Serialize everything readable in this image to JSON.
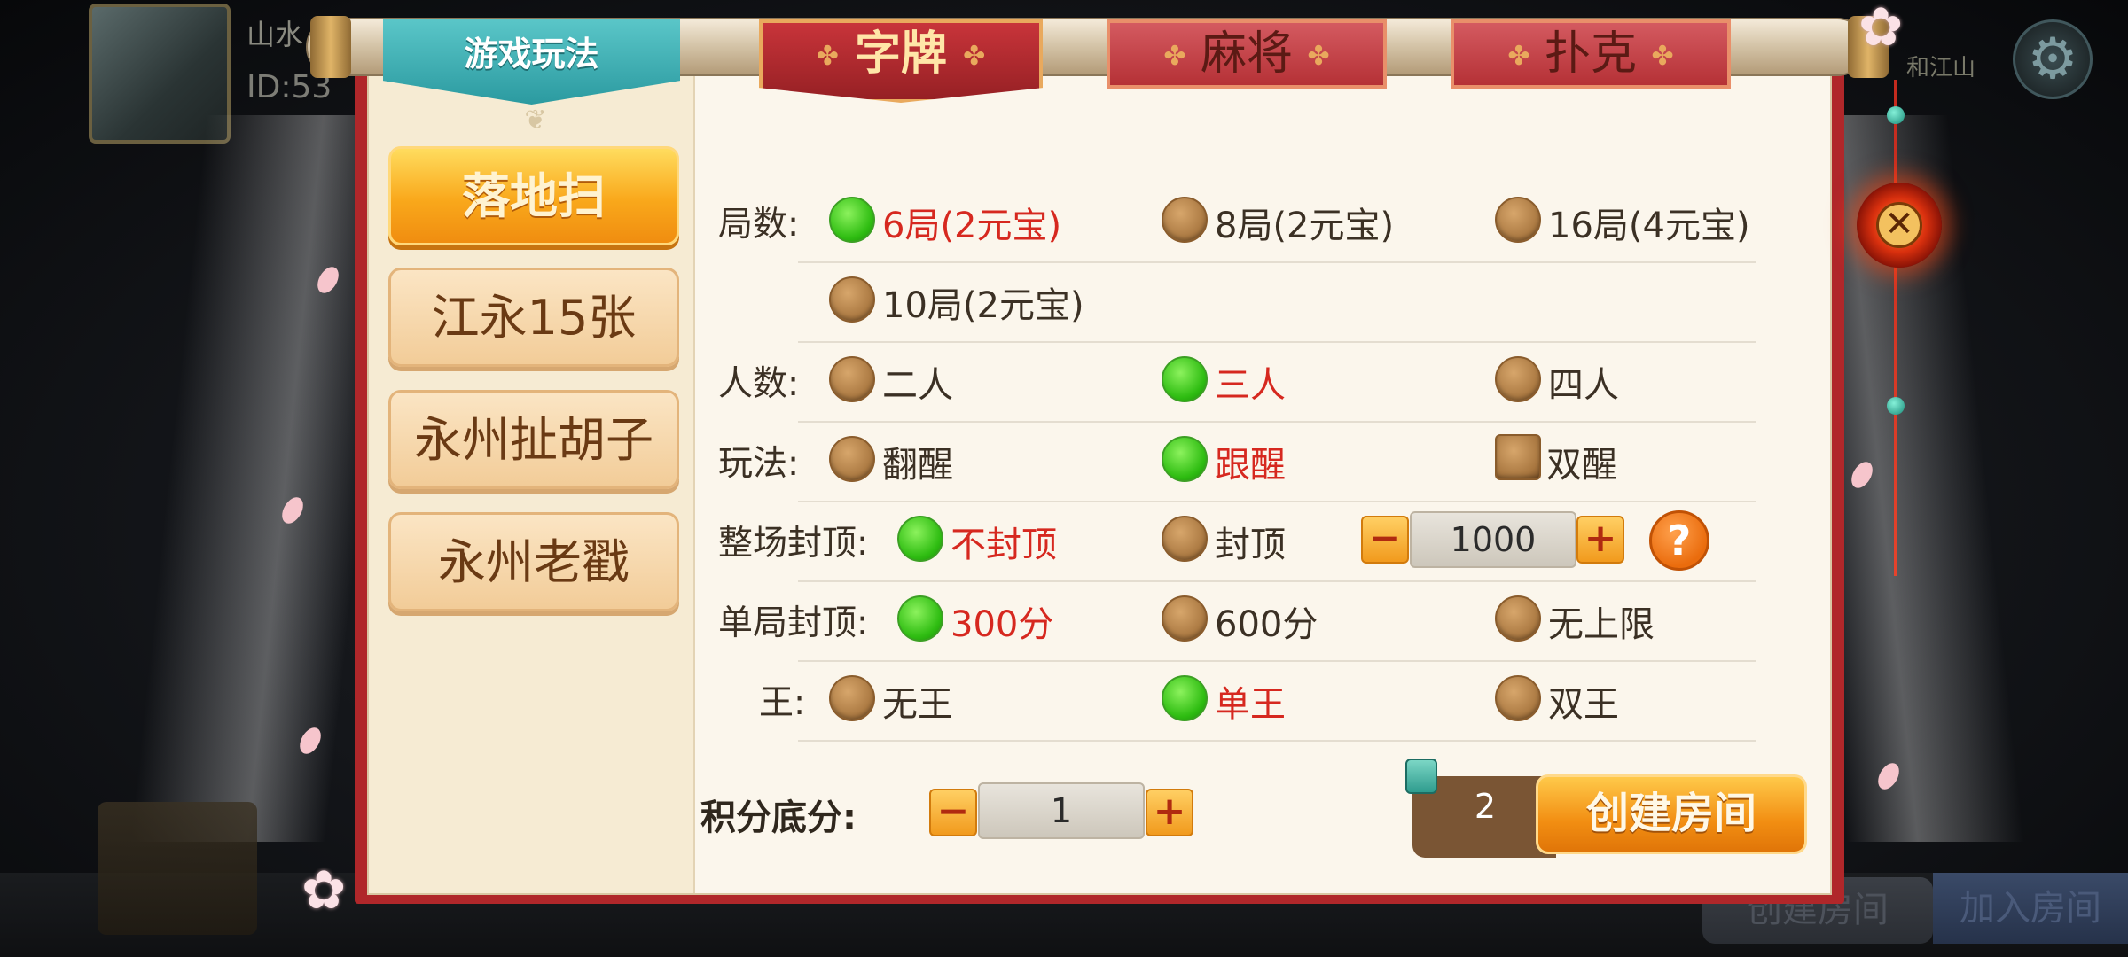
{
  "background": {
    "player_name": "山水",
    "player_id": "ID:53",
    "top_right_text": "和江山",
    "create_room_label": "创建房间",
    "join_room_label": "加入房间"
  },
  "sidebar": {
    "title": "游戏玩法",
    "items": [
      {
        "label": "落地扫",
        "active": true
      },
      {
        "label": "江永15张",
        "active": false
      },
      {
        "label": "永州扯胡子",
        "active": false
      },
      {
        "label": "永州老戳",
        "active": false
      }
    ]
  },
  "categories": [
    {
      "label": "字牌",
      "active": true
    },
    {
      "label": "麻将",
      "active": false
    },
    {
      "label": "扑克",
      "active": false
    }
  ],
  "options": {
    "rounds": {
      "label": "局数:",
      "choices": [
        {
          "text": "6局(2元宝)",
          "selected": true
        },
        {
          "text": "8局(2元宝)",
          "selected": false
        },
        {
          "text": "16局(4元宝)",
          "selected": false
        },
        {
          "text": "10局(2元宝)",
          "selected": false
        }
      ]
    },
    "players": {
      "label": "人数:",
      "choices": [
        {
          "text": "二人",
          "selected": false
        },
        {
          "text": "三人",
          "selected": true
        },
        {
          "text": "四人",
          "selected": false
        }
      ]
    },
    "play_style": {
      "label": "玩法:",
      "choices": [
        {
          "text": "翻醒",
          "selected": false
        },
        {
          "text": "跟醒",
          "selected": true
        },
        {
          "text": "双醒",
          "selected": false
        }
      ]
    },
    "match_cap": {
      "label": "整场封顶:",
      "choices": [
        {
          "text": "不封顶",
          "selected": true
        },
        {
          "text": "封顶",
          "selected": false
        }
      ],
      "cap_value": "1000",
      "help_symbol": "?"
    },
    "round_cap": {
      "label": "单局封顶:",
      "choices": [
        {
          "text": "300分",
          "selected": true
        },
        {
          "text": "600分",
          "selected": false
        },
        {
          "text": "无上限",
          "selected": false
        }
      ]
    },
    "king": {
      "label": "王:",
      "choices": [
        {
          "text": "无王",
          "selected": false
        },
        {
          "text": "单王",
          "selected": true
        },
        {
          "text": "双王",
          "selected": false
        }
      ]
    }
  },
  "base_score": {
    "label": "积分底分:",
    "value": "1"
  },
  "footer": {
    "cost": "2",
    "create_label": "创建房间"
  },
  "symbols": {
    "minus": "−",
    "plus": "+",
    "close": "✕"
  },
  "colors": {
    "selected_text": "#d6281f",
    "radio_on": "#2fbd12",
    "radio_off": "#a8763f",
    "accent_orange": "#f28e12",
    "frame_red": "#b0272a"
  }
}
